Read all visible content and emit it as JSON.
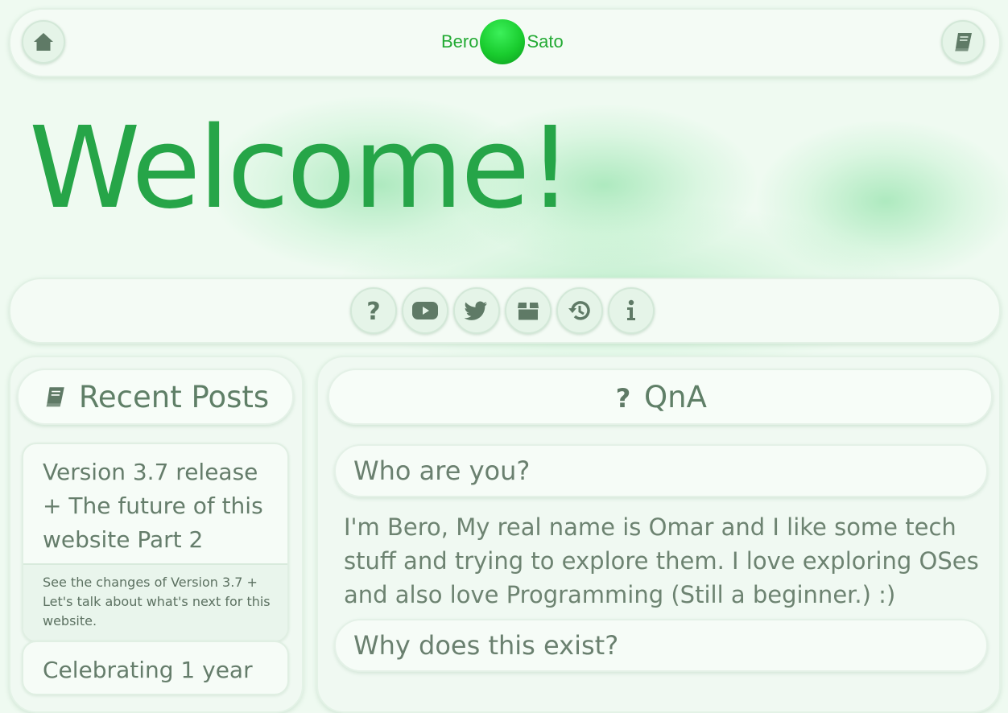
{
  "header": {
    "brand_left": "Bero",
    "brand_right": "Sato",
    "home_icon": "home-icon",
    "blog_icon": "book-icon"
  },
  "hero": {
    "title": "Welcome!"
  },
  "iconbar": {
    "items": [
      {
        "icon": "question-icon"
      },
      {
        "icon": "youtube-icon"
      },
      {
        "icon": "twitter-icon"
      },
      {
        "icon": "box-icon"
      },
      {
        "icon": "history-icon"
      },
      {
        "icon": "info-icon"
      }
    ]
  },
  "recent_posts": {
    "heading": "Recent Posts",
    "posts": [
      {
        "title": "Version 3.7 release + The future of this website Part 2",
        "description": "See the changes of Version 3.7 + Let's talk about what's next for this website."
      },
      {
        "title": "Celebrating 1 year",
        "description": ""
      }
    ]
  },
  "qna": {
    "heading": "QnA",
    "items": [
      {
        "question": "Who are you?",
        "answer": "I'm Bero, My real name is Omar and I like some tech stuff and trying to explore them. I love exploring OSes and also love Programming (Still a beginner.) :)"
      },
      {
        "question": "Why does this exist?",
        "answer": ""
      }
    ]
  },
  "colors": {
    "accent_green": "#26a548",
    "brand_green": "#22aa33",
    "muted_text": "#657d6b",
    "icon_color": "#5f7a66",
    "background": "#effaf1"
  }
}
